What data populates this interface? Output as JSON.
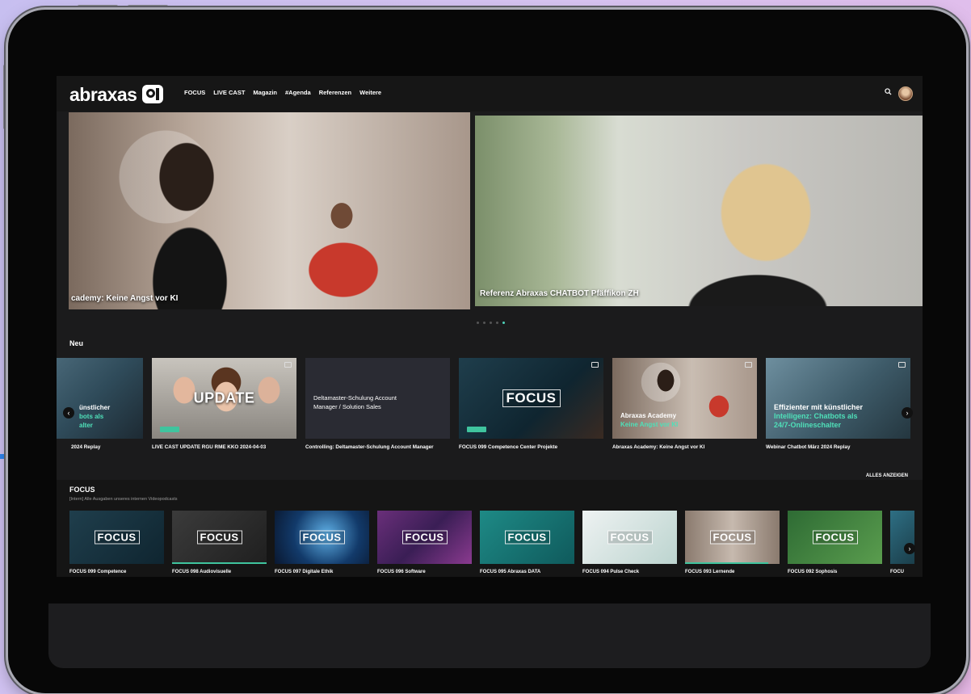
{
  "header": {
    "logo": "abraxas",
    "nav": [
      "FOCUS",
      "LIVE CAST",
      "Magazin",
      "#Agenda",
      "Referenzen",
      "Weitere"
    ]
  },
  "hero": {
    "slides": [
      {
        "caption": "cademy: Keine Angst vor KI"
      },
      {
        "caption": "Referenz Abraxas CHATBOT Pfäffikon ZH"
      }
    ]
  },
  "neu": {
    "title": "Neu",
    "show_all": "ALLES ANZEIGEN",
    "cards": [
      {
        "title": "2024 Replay",
        "thumb_text": "ünstlicher",
        "thumb_text2": "bots als",
        "thumb_text3": "alter"
      },
      {
        "title": "LIVE CAST UPDATE RGU RME KKO 2024-04-03",
        "overlay": "UPDATE"
      },
      {
        "title": "Controlling: Deltamaster-Schulung Account Manager",
        "thumb_text": "Deltamaster-Schulung Account",
        "thumb_text2": "Manager / Solution Sales"
      },
      {
        "title": "FOCUS 099 Competence Center Projekte",
        "overlay": "FOCUS"
      },
      {
        "title": "Abraxas Academy: Keine Angst vor KI",
        "thumb_text": "Abraxas Academy",
        "thumb_text2": "Keine Angst vor KI"
      },
      {
        "title": "Webinar Chatbot März 2024 Replay",
        "thumb_text": "Effizienter mit künstlicher",
        "thumb_text2": "Intelligenz: Chatbots als",
        "thumb_text3": "24/7-Onlineschalter"
      }
    ]
  },
  "focus": {
    "title": "FOCUS",
    "subtitle": "[Intern] Alle Ausgaben unseres internen Videopodcasts",
    "cards": [
      {
        "title": "FOCUS 099 Competence",
        "overlay": "FOCUS"
      },
      {
        "title": "FOCUS 098 Audiovisuelle",
        "overlay": "FOCUS"
      },
      {
        "title": "FOCUS 097 Digitale Ethik",
        "overlay": "FOCUS"
      },
      {
        "title": "FOCUS 096 Software",
        "overlay": "FOCUS"
      },
      {
        "title": "FOCUS 095 Abraxas DATA",
        "overlay": "FOCUS"
      },
      {
        "title": "FOCUS 094 Pulse Check",
        "overlay": "FOCUS"
      },
      {
        "title": "FOCUS 093 Lernende",
        "overlay": "FOCUS"
      },
      {
        "title": "FOCUS 092 Sophosis",
        "overlay": "FOCUS"
      },
      {
        "title": "FOCU",
        "overlay": ""
      }
    ]
  },
  "colors": {
    "accent": "#4fd3b9",
    "side_accent": "#2f86f0",
    "background": "#1b1b1c"
  }
}
